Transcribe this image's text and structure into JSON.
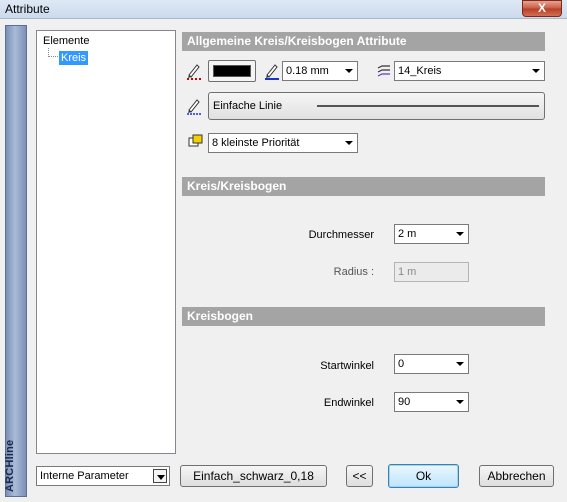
{
  "window": {
    "title": "Attribute",
    "close_label": "X"
  },
  "sidebar": {
    "label": "ARCHline"
  },
  "tree": {
    "root": "Elemente",
    "child": "Kreis"
  },
  "general": {
    "header": "Allgemeine Kreis/Kreisbogen Attribute",
    "pen_color": "#000000",
    "line_width": "0.18 mm",
    "layer": "14_Kreis",
    "line_type": "Einfache Linie",
    "priority": "8 kleinste Priorität"
  },
  "circle": {
    "header": "Kreis/Kreisbogen",
    "diameter_label": "Durchmesser",
    "diameter_value": "2 m",
    "radius_label": "Radius :",
    "radius_value": "1 m"
  },
  "arc": {
    "header": "Kreisbogen",
    "start_label": "Startwinkel",
    "start_value": "0",
    "end_label": "Endwinkel",
    "end_value": "90"
  },
  "footer": {
    "params": "Interne Parameter",
    "style": "Einfach_schwarz_0,18",
    "back": "<<",
    "ok": "Ok",
    "cancel": "Abbrechen"
  },
  "icons": {
    "pen_color_icon": "pen-color-icon",
    "line_width_icon": "pen-width-icon",
    "layer_icon": "layers-icon",
    "line_type_icon": "line-type-icon",
    "priority_icon": "priority-icon"
  }
}
